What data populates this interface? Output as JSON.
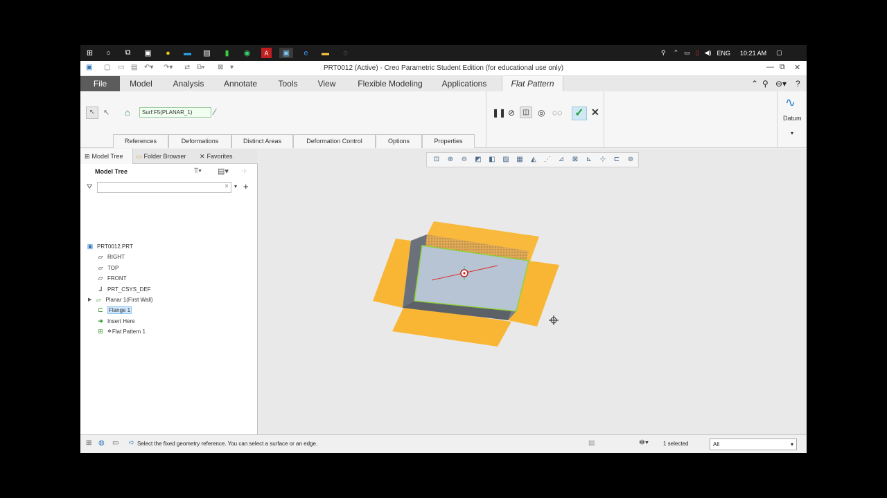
{
  "taskbar": {
    "language": "ENG",
    "time": "10:21 AM"
  },
  "window": {
    "title": "PRT0012 (Active) - Creo Parametric Student Edition (for educational use only)"
  },
  "ribbon_tabs": [
    "File",
    "Model",
    "Analysis",
    "Annotate",
    "Tools",
    "View",
    "Flexible Modeling",
    "Applications",
    "Flat Pattern"
  ],
  "ribbon": {
    "reference_field": "Surf:F5(PLANAR_1)",
    "subtabs": [
      "References",
      "Deformations",
      "Distinct Areas",
      "Deformation Control",
      "Options",
      "Properties"
    ],
    "datum_label": "Datum"
  },
  "left_panel": {
    "tabs": [
      "Model Tree",
      "Folder Browser",
      "Favorites"
    ],
    "header": "Model Tree",
    "filter_value": "",
    "tree": [
      {
        "label": "PRT0012.PRT",
        "icon": "part-icon"
      },
      {
        "label": "RIGHT",
        "icon": "datum-plane-icon"
      },
      {
        "label": "TOP",
        "icon": "datum-plane-icon"
      },
      {
        "label": "FRONT",
        "icon": "datum-plane-icon"
      },
      {
        "label": "PRT_CSYS_DEF",
        "icon": "csys-icon"
      },
      {
        "label": "Planar 1(First Wall)",
        "icon": "planar-wall-icon"
      },
      {
        "label": "Flange 1",
        "icon": "flange-icon"
      },
      {
        "label": "Insert Here",
        "icon": "insert-arrow-icon"
      },
      {
        "label": "Flat Pattern 1",
        "icon": "flat-pattern-icon"
      }
    ]
  },
  "status": {
    "message": "Select the fixed geometry reference. You can select a surface or an edge.",
    "selected": "1 selected",
    "filter": "All"
  },
  "colors": {
    "flange_orange": "#f9b634",
    "face_blue": "#b7c4d4",
    "side_dark": "#6b717a",
    "edge_green": "#8fd13c"
  }
}
